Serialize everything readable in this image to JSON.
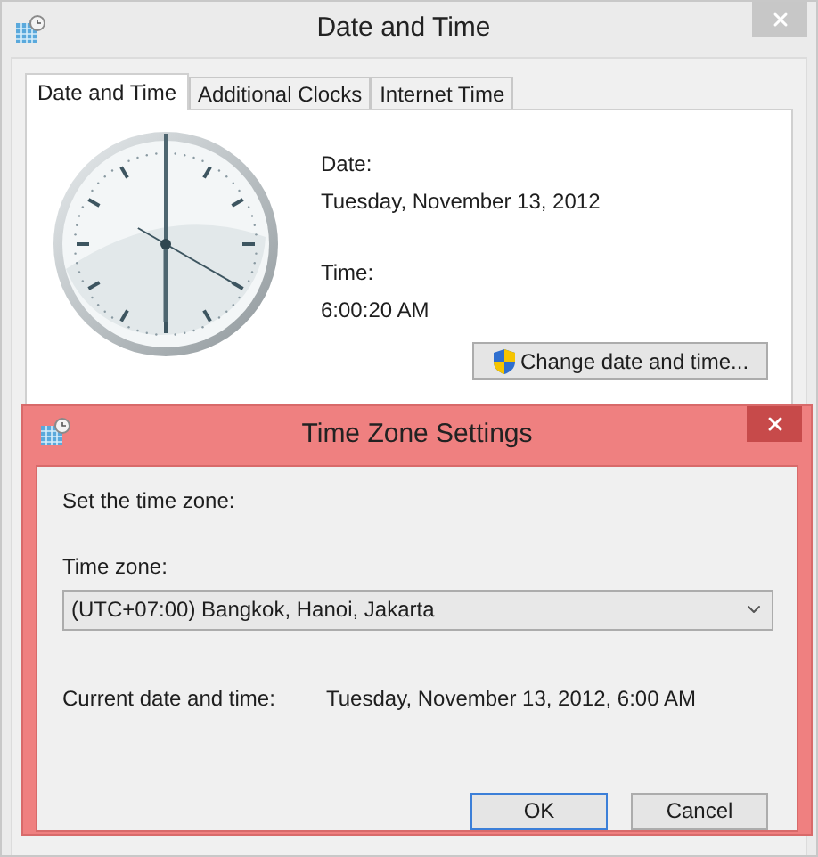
{
  "window": {
    "title": "Date and Time"
  },
  "tabs": [
    {
      "label": "Date and Time",
      "selected": true
    },
    {
      "label": "Additional Clocks",
      "selected": false
    },
    {
      "label": "Internet Time",
      "selected": false
    }
  ],
  "date": {
    "label": "Date:",
    "value": "Tuesday, November 13, 2012"
  },
  "time": {
    "label": "Time:",
    "value": "6:00:20 AM"
  },
  "change_button": "Change date and time...",
  "dialog": {
    "title": "Time Zone Settings",
    "instruction": "Set the time zone:",
    "time_zone": {
      "label": "Time zone:",
      "value": "(UTC+07:00) Bangkok, Hanoi, Jakarta"
    },
    "current": {
      "label": "Current date and time:",
      "value": "Tuesday, November 13, 2012, 6:00 AM"
    },
    "buttons": [
      {
        "label": "OK",
        "default": true
      },
      {
        "label": "Cancel",
        "default": false
      }
    ]
  }
}
